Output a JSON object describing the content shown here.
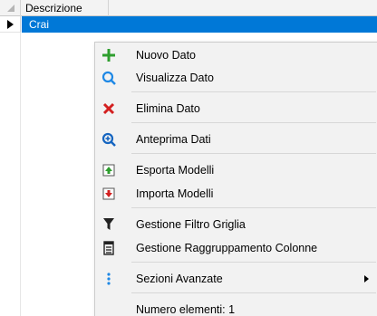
{
  "grid": {
    "column_header": "Descrizione",
    "rows": [
      {
        "value": "Crai",
        "selected": true
      }
    ],
    "selection_color": "#0078d7"
  },
  "context_menu": {
    "items": [
      {
        "label": "Nuovo Dato",
        "icon": "plus-icon",
        "icon_color": "#2e9e2e"
      },
      {
        "label": "Visualizza Dato",
        "icon": "magnifier-icon",
        "icon_color": "#1e88e5"
      },
      {
        "label": "Elimina Dato",
        "icon": "delete-x-icon",
        "icon_color": "#d32020"
      },
      {
        "label": "Anteprima Dati",
        "icon": "zoom-in-icon",
        "icon_color": "#1565c0"
      },
      {
        "label": "Esporta Modelli",
        "icon": "export-icon",
        "icon_color": "#2e9e2e"
      },
      {
        "label": "Importa Modelli",
        "icon": "import-icon",
        "icon_color": "#d32020"
      },
      {
        "label": "Gestione Filtro Griglia",
        "icon": "filter-icon",
        "icon_color": "#222222"
      },
      {
        "label": "Gestione Raggruppamento Colonne",
        "icon": "group-columns-icon",
        "icon_color": "#222222"
      },
      {
        "label": "Sezioni Avanzate",
        "icon": "more-vertical-icon",
        "icon_color": "#1e88e5",
        "has_submenu": true
      },
      {
        "label": "Numero elementi: 1",
        "icon": "",
        "icon_color": ""
      }
    ]
  }
}
